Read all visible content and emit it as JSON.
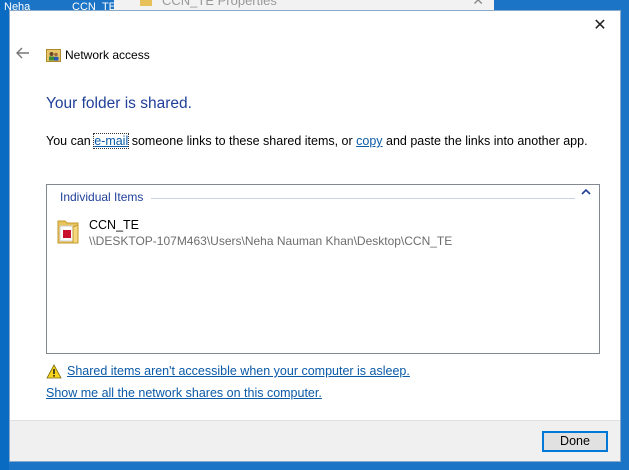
{
  "background": {
    "desktop_fragments": [
      "Neha",
      "CCN_TE"
    ],
    "behind_window_title": "CCN_TE Properties"
  },
  "dialog": {
    "header_title": "Network access",
    "heading": "Your folder is shared.",
    "desc": {
      "part1": "You can ",
      "email_link": "e-mail",
      "part2": " someone links to these shared items, or ",
      "copy_link": "copy",
      "part3": " and paste the links into another app."
    },
    "group": {
      "label": "Individual Items",
      "items": [
        {
          "name": "CCN_TE",
          "path": "\\\\DESKTOP-107M463\\Users\\Neha Nauman Khan\\Desktop\\CCN_TE"
        }
      ]
    },
    "warning_link": "Shared items aren't accessible when your computer is asleep.",
    "shares_link": "Show me all the network shares on this computer.",
    "done_label": "Done"
  },
  "icons": {
    "back": "back-arrow-icon",
    "close": "close-icon",
    "network": "network-users-icon",
    "folder": "folder-icon",
    "warning": "warning-icon",
    "collapse": "chevron-up-icon"
  },
  "colors": {
    "accent": "#0078d7",
    "heading": "#1f3f99",
    "link": "#0a5aa8"
  }
}
